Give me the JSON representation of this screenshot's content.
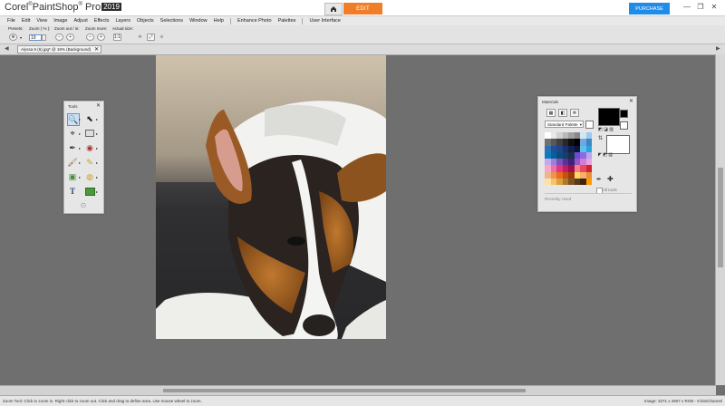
{
  "app": {
    "logo_brand": "Corel",
    "logo_product": "PaintShop",
    "logo_pro": "Pro",
    "logo_version": "2019",
    "home_icon": "home-icon",
    "edit_tab": "EDIT",
    "purchase": "PURCHASE",
    "minimize": "—",
    "restore": "❐",
    "close": "✕"
  },
  "menu": {
    "items": [
      "File",
      "Edit",
      "View",
      "Image",
      "Adjust",
      "Effects",
      "Layers",
      "Objects",
      "Selections",
      "Window",
      "Help",
      "Enhance Photo",
      "Palettes",
      "User Interface"
    ]
  },
  "tool_options": {
    "presets_label": "Presets:",
    "zoom_label": "Zoom ( % ):",
    "zoom_value": "19",
    "zoom_inout_label": "Zoom out / in:",
    "zoom_more_label": "Zoom more:",
    "actual_size_label": "Actual size:"
  },
  "document_tab": {
    "label": "Alyssa 6 (6).jpg*  @   19% (Background)",
    "close": "✕"
  },
  "tools_palette": {
    "title": "Tools",
    "close": "✕",
    "tools": [
      "zoom-icon",
      "pick-icon",
      "clone-icon",
      "selection-icon",
      "dropper-icon",
      "red-eye-icon",
      "paintbrush-icon",
      "lighten-darken-icon",
      "smart-carver-icon",
      "flood-fill-icon",
      "text-icon",
      "rectangle-shape-icon",
      "more-tools-icon"
    ]
  },
  "materials": {
    "title": "Materials",
    "close": "✕",
    "palette_select": "Standard Palette",
    "all_tools": "All tools",
    "recently_used": "Recently Used",
    "fg_color": "#000000",
    "bg_color": "#ffffff",
    "swatch_colors": [
      "#ffffff",
      "#e8e8e8",
      "#d0d0d0",
      "#b8b8b8",
      "#a0a0a0",
      "#888888",
      "#d5e6f3",
      "#9ec8ee",
      "#707070",
      "#585858",
      "#404040",
      "#282828",
      "#101010",
      "#000000",
      "#6fa8dc",
      "#3d85c6",
      "#2e6fb5",
      "#1f4e9c",
      "#224488",
      "#1c2f6e",
      "#142050",
      "#0d143a",
      "#5bc0ea",
      "#29a2d8",
      "#0b7bbf",
      "#086099",
      "#0a4d7a",
      "#154066",
      "#1b2e4a",
      "#6c4bd3",
      "#8a6be0",
      "#b8a6f0",
      "#c3a9ef",
      "#a07fd8",
      "#7a52b9",
      "#5e2f99",
      "#40217a",
      "#9d54c2",
      "#cf7dd7",
      "#eaa0e0",
      "#f4a7c9",
      "#ee6fa8",
      "#e0377f",
      "#c21c63",
      "#9b0f4b",
      "#f2818c",
      "#e84c5a",
      "#cf2230",
      "#f3b38a",
      "#f09250",
      "#e96d1f",
      "#c4520e",
      "#9b3c0a",
      "#ffd966",
      "#f6b26b",
      "#e69138",
      "#fbe4a0",
      "#f6c36b",
      "#d9a041",
      "#a97b2c",
      "#7a5524",
      "#5a3a1a",
      "#3e2510",
      "#ff9900"
    ]
  },
  "statusbar": {
    "hint": "Zoom Tool: Click to zoom in. Right click to zoom out. Click and drag to define area. Use mouse wheel to zoom.",
    "image_info": "Image:  3271 x 4907 x RGB - 8 bits/channel"
  }
}
